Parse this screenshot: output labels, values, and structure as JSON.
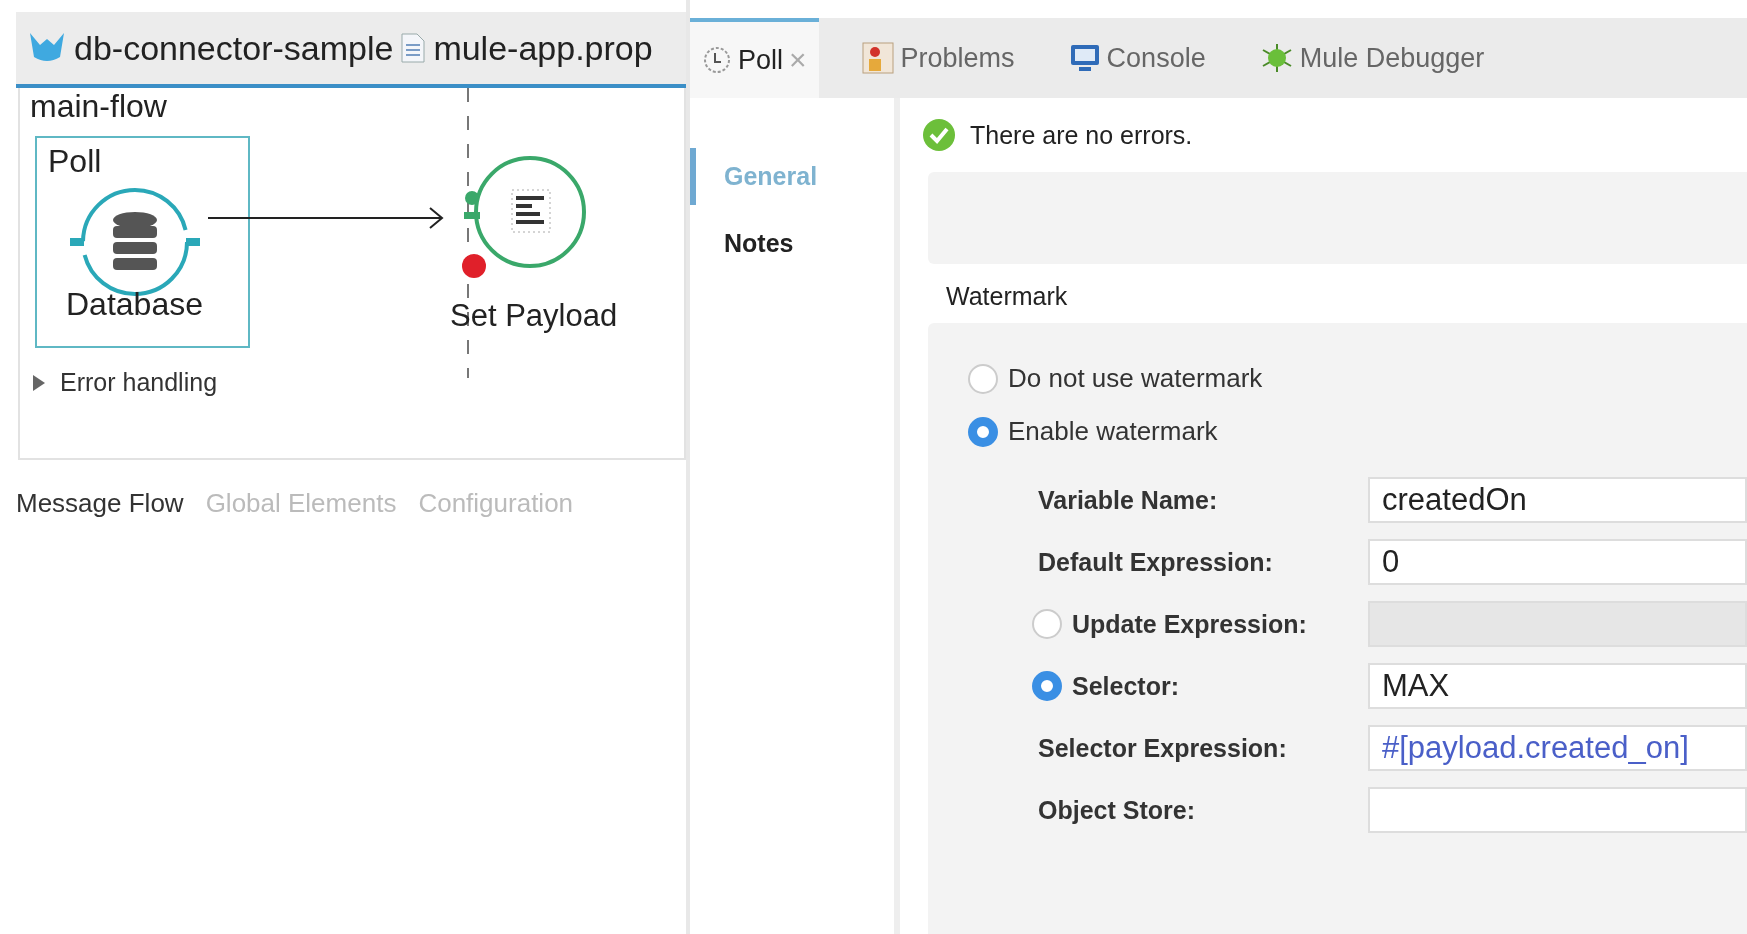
{
  "editor_tabs": [
    "db-connector-sample",
    "mule-app.prop"
  ],
  "flow": {
    "name": "main-flow",
    "scope_label": "Poll",
    "source_label": "Database",
    "processor_label": "Set Payload",
    "breakpoint": true,
    "error_handling": {
      "label": "Error handling",
      "expanded": false
    }
  },
  "view_tabs": [
    {
      "label": "Message Flow",
      "selected": true
    },
    {
      "label": "Global Elements",
      "selected": false
    },
    {
      "label": "Configuration",
      "selected": false
    }
  ],
  "panel_tabs": [
    {
      "label": "Poll",
      "close": "×",
      "selected": true
    },
    {
      "label": "Problems",
      "selected": false
    },
    {
      "label": "Console",
      "selected": false
    },
    {
      "label": "Mule Debugger",
      "selected": false
    }
  ],
  "nav": [
    {
      "label": "General",
      "selected": true
    },
    {
      "label": "Notes",
      "selected": false
    }
  ],
  "status": "There are no errors.",
  "section_title": "Watermark",
  "watermark_options": [
    {
      "label": "Do not use watermark",
      "selected": false
    },
    {
      "label": "Enable watermark",
      "selected": true
    }
  ],
  "fields": [
    {
      "kind": "plain",
      "label": "Variable Name:",
      "value": "createdOn",
      "disabled": false
    },
    {
      "kind": "plain",
      "label": "Default Expression:",
      "value": "0",
      "disabled": false
    },
    {
      "kind": "radio",
      "label": "Update Expression:",
      "selected": false,
      "disabled": true
    },
    {
      "kind": "radio",
      "label": "Selector:",
      "value": "MAX",
      "selected": true,
      "disabled": false
    },
    {
      "kind": "expression",
      "label": "Selector Expression:",
      "value": "#[payload.created_on]",
      "disabled": false
    },
    {
      "kind": "plain",
      "label": "Object Store:",
      "disabled": false
    }
  ]
}
